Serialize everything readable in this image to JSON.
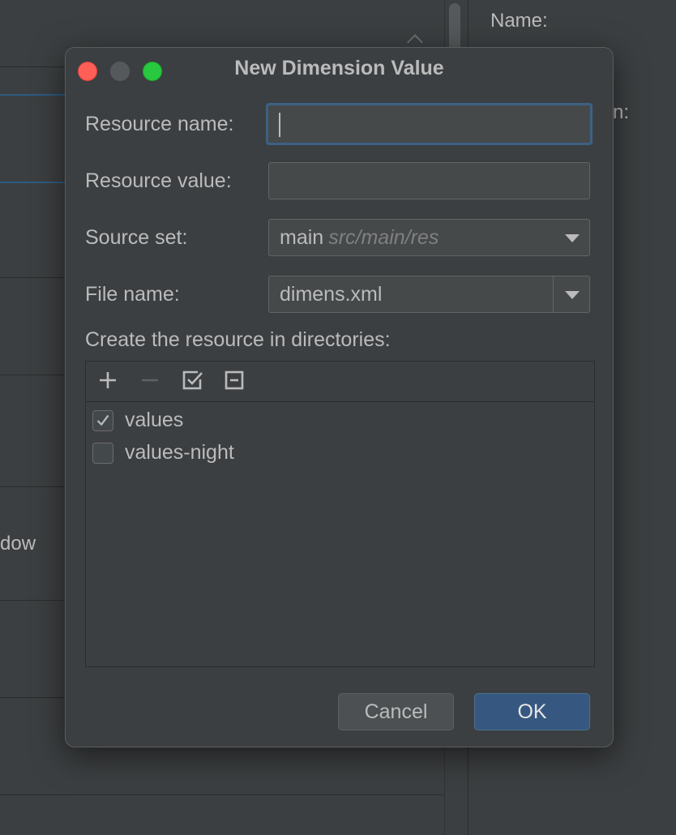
{
  "background": {
    "right_panel_label_1": "Name:",
    "right_panel_label_2": "n:",
    "left_fragment": "dow"
  },
  "dialog": {
    "title": "New Dimension Value",
    "resource_name": {
      "label": "Resource name:",
      "value": ""
    },
    "resource_value": {
      "label": "Resource value:",
      "value": ""
    },
    "source_set": {
      "label": "Source set:",
      "value": "main",
      "hint": "src/main/res"
    },
    "file_name": {
      "label": "File name:",
      "value": "dimens.xml"
    },
    "directories": {
      "label": "Create the resource in directories:",
      "toolbar": [
        "add-icon",
        "remove-icon",
        "check-all-icon",
        "uncheck-all-icon"
      ],
      "items": [
        {
          "label": "values",
          "checked": true
        },
        {
          "label": "values-night",
          "checked": false
        }
      ]
    },
    "buttons": {
      "cancel": "Cancel",
      "ok": "OK"
    }
  },
  "colors": {
    "accent": "#365880",
    "focus_border": "#3d6185",
    "close": "#ff5f57",
    "maximize": "#28c840"
  }
}
